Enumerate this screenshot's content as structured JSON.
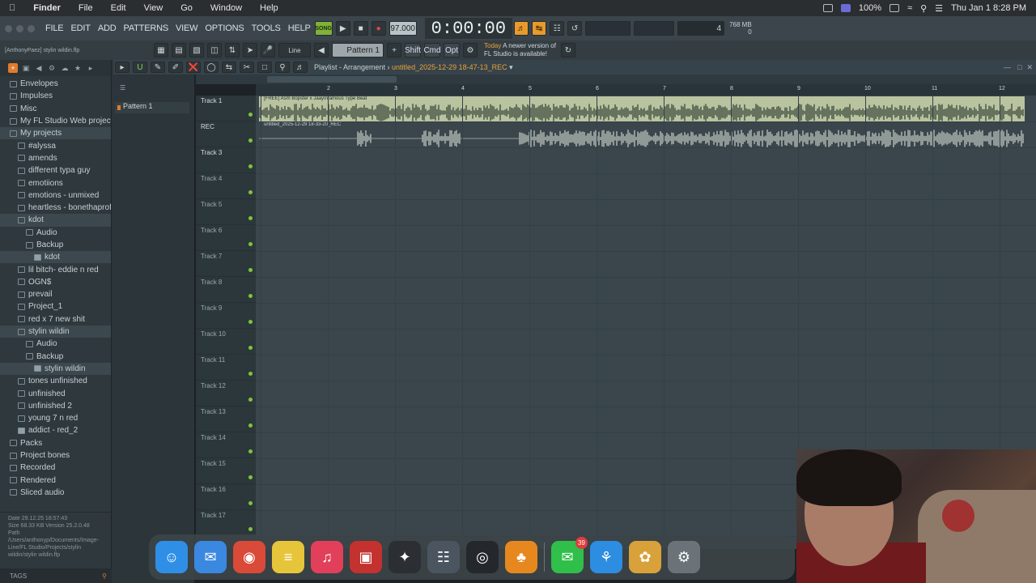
{
  "menubar": {
    "app": "Finder",
    "items": [
      "File",
      "Edit",
      "View",
      "Go",
      "Window",
      "Help"
    ],
    "battery": "100%",
    "clock": "Thu Jan 1  8:28 PM"
  },
  "fl": {
    "menu": [
      "FILE",
      "EDIT",
      "ADD",
      "PATTERNS",
      "VIEW",
      "OPTIONS",
      "TOOLS",
      "HELP"
    ],
    "song_btn": "SONG",
    "tempo": "97.000",
    "time": "0:00:00",
    "cpu_label": "4",
    "ram_label": "768 MB",
    "ram_sub": "0",
    "user_file": "[AnthonyPaez] stylin wildin.flp",
    "snap": "Line",
    "pattern": "Pattern 1",
    "mods": [
      "Shift",
      "Cmd",
      "Opt"
    ],
    "news_prefix": "Today",
    "news_line1": "A newer version of",
    "news_line2": "FL Studio is available!"
  },
  "browser": {
    "items": [
      {
        "label": "Envelopes",
        "indent": 0,
        "kind": "folder"
      },
      {
        "label": "Impulses",
        "indent": 0,
        "kind": "folder"
      },
      {
        "label": "Misc",
        "indent": 0,
        "kind": "folder"
      },
      {
        "label": "My FL Studio Web projects",
        "indent": 0,
        "kind": "folder"
      },
      {
        "label": "My projects",
        "indent": 0,
        "kind": "folder",
        "sel": true
      },
      {
        "label": "#alyssa",
        "indent": 1,
        "kind": "folder"
      },
      {
        "label": "amends",
        "indent": 1,
        "kind": "folder"
      },
      {
        "label": "different typa guy",
        "indent": 1,
        "kind": "folder"
      },
      {
        "label": "emotiions",
        "indent": 1,
        "kind": "folder"
      },
      {
        "label": "emotions - unmixed",
        "indent": 1,
        "kind": "folder"
      },
      {
        "label": "heartless - bonethaprofit",
        "indent": 1,
        "kind": "folder"
      },
      {
        "label": "kdot",
        "indent": 1,
        "kind": "folder",
        "sel": true
      },
      {
        "label": "Audio",
        "indent": 2,
        "kind": "folder"
      },
      {
        "label": "Backup",
        "indent": 2,
        "kind": "folder"
      },
      {
        "label": "kdot",
        "indent": 3,
        "kind": "file",
        "sel": true
      },
      {
        "label": "lil bitch- eddie n red",
        "indent": 1,
        "kind": "folder"
      },
      {
        "label": "OGN$",
        "indent": 1,
        "kind": "folder"
      },
      {
        "label": "prevail",
        "indent": 1,
        "kind": "folder"
      },
      {
        "label": "Project_1",
        "indent": 1,
        "kind": "folder"
      },
      {
        "label": "red x 7 new shit",
        "indent": 1,
        "kind": "folder"
      },
      {
        "label": "stylin wildin",
        "indent": 1,
        "kind": "folder",
        "sel": true
      },
      {
        "label": "Audio",
        "indent": 2,
        "kind": "folder"
      },
      {
        "label": "Backup",
        "indent": 2,
        "kind": "folder"
      },
      {
        "label": "stylin wildin",
        "indent": 3,
        "kind": "file",
        "sel": true
      },
      {
        "label": "tones unfinished",
        "indent": 1,
        "kind": "folder"
      },
      {
        "label": "unfinished",
        "indent": 1,
        "kind": "folder"
      },
      {
        "label": "unfinished 2",
        "indent": 1,
        "kind": "folder"
      },
      {
        "label": "young 7 n red",
        "indent": 1,
        "kind": "folder"
      },
      {
        "label": "addict - red_2",
        "indent": 1,
        "kind": "file"
      },
      {
        "label": "Packs",
        "indent": 0,
        "kind": "folder"
      },
      {
        "label": "Project bones",
        "indent": 0,
        "kind": "folder"
      },
      {
        "label": "Recorded",
        "indent": 0,
        "kind": "folder"
      },
      {
        "label": "Rendered",
        "indent": 0,
        "kind": "folder"
      },
      {
        "label": "Sliced audio",
        "indent": 0,
        "kind": "folder"
      }
    ],
    "info_date": "Date     29.12.25 18:57:43",
    "info_size": "Size     68.33 KB      Version 25.2.0.48",
    "info_path": "Path     /Users/anthonyp/Documents/Image-Line/FL Studio/Projects/stylin wildin/stylin wildin.flp",
    "tags": "TAGS"
  },
  "channels": {
    "pattern_item": "Pattern 1"
  },
  "playlist": {
    "title_prefix": "Playlist - Arrangement",
    "title_file": "untitled_2025-12-29 18-47-13_REC",
    "ruler": [
      "2",
      "3",
      "4",
      "5",
      "6",
      "7",
      "8",
      "9",
      "10",
      "11",
      "12"
    ],
    "tracks": [
      "Track 1",
      "REC",
      "Track 3",
      "Track 4",
      "Track 5",
      "Track 6",
      "Track 7",
      "Track 8",
      "Track 9",
      "Track 10",
      "Track 11",
      "Track 12",
      "Track 13",
      "Track 14",
      "Track 15",
      "Track 16",
      "Track 17"
    ],
    "clip1": "[FREE] Asm Bopster x JaayInfamous Type Beat",
    "clip2": "untitled_2025-12-29 18-33-20_REC"
  },
  "dock": [
    {
      "name": "finder",
      "color": "#2f8fe6",
      "glyph": "☺"
    },
    {
      "name": "mail",
      "color": "#3b88e0",
      "glyph": "✉"
    },
    {
      "name": "chrome",
      "color": "#d94a38",
      "glyph": "◉"
    },
    {
      "name": "notes",
      "color": "#e7c53a",
      "glyph": "≡"
    },
    {
      "name": "music",
      "color": "#e2405a",
      "glyph": "♫"
    },
    {
      "name": "photo-booth",
      "color": "#c3322e",
      "glyph": "▣"
    },
    {
      "name": "unity",
      "color": "#2b2f33",
      "glyph": "✦"
    },
    {
      "name": "launchpad",
      "color": "#4a5560",
      "glyph": "☷"
    },
    {
      "name": "obs",
      "color": "#24282c",
      "glyph": "◎",
      "badge": ""
    },
    {
      "name": "fl-studio",
      "color": "#e7881f",
      "glyph": "♣"
    },
    {
      "name": "messages",
      "color": "#2fbf4a",
      "glyph": "✉",
      "badge": "39"
    },
    {
      "name": "safari",
      "color": "#2d8de0",
      "glyph": "⚘"
    },
    {
      "name": "photos",
      "color": "#d9a13a",
      "glyph": "✿"
    },
    {
      "name": "system-settings",
      "color": "#6b7379",
      "glyph": "⚙"
    }
  ]
}
